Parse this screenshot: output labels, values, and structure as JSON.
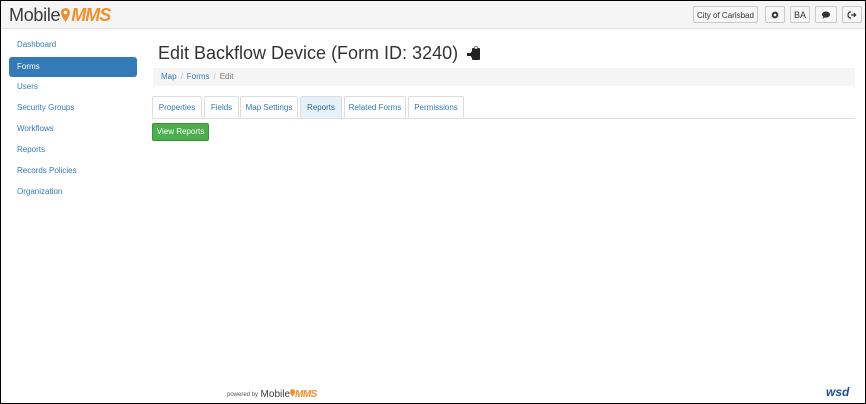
{
  "header": {
    "logo_part1": "Mobile",
    "logo_part2": "MMS",
    "city_button": "City of Carlsbad",
    "user_initials": "BA",
    "settings_icon": "gear-icon",
    "chat_icon": "comment-icon",
    "logout_icon": "sign-out-icon"
  },
  "sidebar": {
    "items": [
      {
        "label": "Dashboard"
      },
      {
        "label": "Forms"
      },
      {
        "label": "Users"
      },
      {
        "label": "Security Groups"
      },
      {
        "label": "Workflows"
      },
      {
        "label": "Reports"
      },
      {
        "label": "Records Policies"
      },
      {
        "label": "Organization"
      }
    ],
    "active_index": 1
  },
  "main": {
    "title": "Edit Backflow Device (Form ID: 3240)",
    "title_icon": "clipboard-arrow-icon",
    "breadcrumb": [
      "Map",
      "Forms",
      "Edit"
    ],
    "tabs": [
      {
        "label": "Properties"
      },
      {
        "label": "Fields"
      },
      {
        "label": "Map Settings"
      },
      {
        "label": "Reports"
      },
      {
        "label": "Related Forms"
      },
      {
        "label": "Permissions"
      }
    ],
    "active_tab": 3,
    "view_reports_button": "View Reports"
  },
  "footer": {
    "powered_by": "powered by",
    "logo_part1": "Mobile",
    "logo_part2": "MMS",
    "wsd": "wsd"
  },
  "colors": {
    "link": "#337ab7",
    "active_nav_bg": "#337ab7",
    "brand_orange": "#f0902a",
    "green_button": "#4cae4c",
    "active_tab_bg": "#e6f1f8"
  }
}
